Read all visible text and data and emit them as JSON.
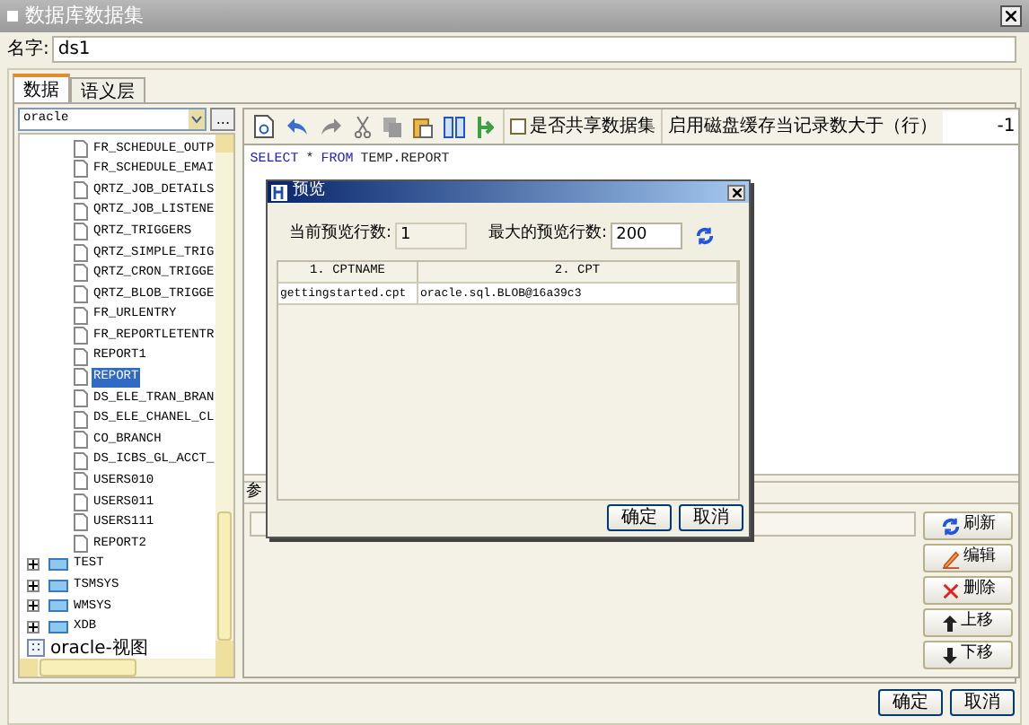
{
  "window": {
    "title": "数据库数据集"
  },
  "name_field": {
    "label": "名字:",
    "value": "ds1"
  },
  "tabs": [
    {
      "label": "数据",
      "selected": true
    },
    {
      "label": "语义层",
      "selected": false
    }
  ],
  "connection": {
    "value": "oracle",
    "more_button": "..."
  },
  "tree": [
    {
      "children": [
        {
          "label": "FR_SCHEDULE_OUTP",
          "selected": false
        },
        {
          "label": "FR_SCHEDULE_EMAI",
          "selected": false
        },
        {
          "label": "QRTZ_JOB_DETAILS",
          "selected": false
        },
        {
          "label": "QRTZ_JOB_LISTENE",
          "selected": false
        },
        {
          "label": "QRTZ_TRIGGERS",
          "selected": false
        },
        {
          "label": "QRTZ_SIMPLE_TRIG",
          "selected": false
        },
        {
          "label": "QRTZ_CRON_TRIGGE",
          "selected": false
        },
        {
          "label": "QRTZ_BLOB_TRIGGE",
          "selected": false
        },
        {
          "label": "FR_URLENTRY",
          "selected": false
        },
        {
          "label": "FR_REPORTLETENTR",
          "selected": false
        },
        {
          "label": "REPORT1",
          "selected": false
        },
        {
          "label": "REPORT",
          "selected": true
        },
        {
          "label": "DS_ELE_TRAN_BRAN",
          "selected": false
        },
        {
          "label": "DS_ELE_CHANEL_CL",
          "selected": false
        },
        {
          "label": "CO_BRANCH",
          "selected": false
        },
        {
          "label": "DS_ICBS_GL_ACCT_",
          "selected": false
        },
        {
          "label": "USERS010",
          "selected": false
        },
        {
          "label": "USERS011",
          "selected": false
        },
        {
          "label": "USERS111",
          "selected": false
        },
        {
          "label": "REPORT2",
          "selected": false
        }
      ]
    },
    {
      "label": "TEST",
      "kind": "schema",
      "expanded": false
    },
    {
      "label": "TSMSYS",
      "kind": "schema",
      "expanded": false
    },
    {
      "label": "WMSYS",
      "kind": "schema",
      "expanded": false
    },
    {
      "label": "XDB",
      "kind": "schema",
      "expanded": false
    },
    {
      "label": "oracle-视图",
      "kind": "view_root"
    }
  ],
  "toolbar": {
    "share_checkbox": {
      "label": "是否共享数据集",
      "checked": false
    },
    "cache_label": "启用磁盘缓存当记录数大于（行）",
    "cache_value": "-1"
  },
  "sql": [
    {
      "text": "SELECT",
      "kind": "keyword"
    },
    {
      "text": "*",
      "kind": "plain"
    },
    {
      "text": "FROM",
      "kind": "keyword"
    },
    {
      "text": "TEMP.REPORT",
      "kind": "plain"
    }
  ],
  "params_tab": {
    "label": "参"
  },
  "side_buttons": [
    {
      "label": "刷新",
      "kind": "refresh"
    },
    {
      "label": "编辑",
      "kind": "edit"
    },
    {
      "label": "删除",
      "kind": "delete"
    },
    {
      "label": "上移",
      "kind": "up"
    },
    {
      "label": "下移",
      "kind": "down"
    }
  ],
  "footer_buttons": [
    "确定",
    "取消"
  ],
  "preview_dialog": {
    "title": "预览",
    "current_rows_label": "当前预览行数:",
    "current_rows": "1",
    "max_rows_label": "最大的预览行数:",
    "max_rows": "200",
    "columns": [
      "1. CPTNAME",
      "2. CPT"
    ],
    "rows": [
      [
        "gettingstarted.cpt",
        "oracle.sql.BLOB@16a39c3"
      ]
    ],
    "buttons": [
      "确定",
      "取消"
    ]
  }
}
